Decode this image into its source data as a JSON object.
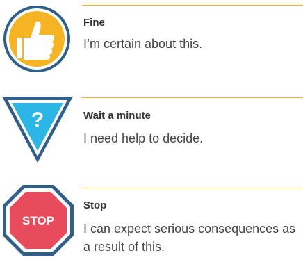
{
  "items": [
    {
      "icon": "thumbs-up-icon",
      "title": "Fine",
      "description": "I’m certain about this.",
      "color": "#f4b423"
    },
    {
      "icon": "question-triangle-icon",
      "title": "Wait a minute",
      "description": "I need help to decide.",
      "color": "#2bb6e5"
    },
    {
      "icon": "stop-sign-icon",
      "title": "Stop",
      "description": "I can expect serious consequences as a result of this.",
      "color": "#e84b5b",
      "sign_text": "STOP"
    }
  ],
  "colors": {
    "rule": "#f4b423",
    "outline": "#2f5f8a"
  }
}
